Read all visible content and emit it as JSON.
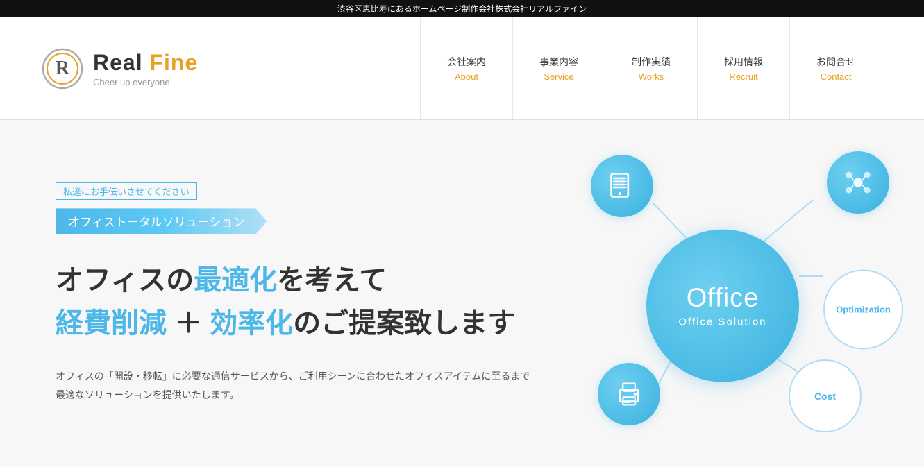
{
  "topbar": {
    "text": "渋谷区恵比寿にあるホームページ制作会社株式会社リアルファイン"
  },
  "header": {
    "logo": {
      "name_part1": "Real ",
      "name_part2": "Fine",
      "tagline": "Cheer up everyone"
    },
    "nav": [
      {
        "ja": "会社案内",
        "en": "About"
      },
      {
        "ja": "事業内容",
        "en": "Service"
      },
      {
        "ja": "制作実績",
        "en": "Works"
      },
      {
        "ja": "採用情報",
        "en": "Recruit"
      },
      {
        "ja": "お問合せ",
        "en": "Contact"
      }
    ]
  },
  "hero": {
    "sub_label": "私達にお手伝いさせてください",
    "badge": "オフィストータルソリューション",
    "title_line1_pre": "オフィスの",
    "title_line1_highlight": "最適化",
    "title_line1_post": "を考えて",
    "title_line2_highlight1": "経費削減",
    "title_line2_mid": "  ＋  ",
    "title_line2_highlight2": "効率化",
    "title_line2_post": "のご提案致します",
    "description_line1": "オフィスの「開設・移転」に必要な通信サービスから、ご利用シーンに合わせたオフィスアイテムに至るまで",
    "description_line2": "最適なソリューションを提供いたします。",
    "diagram": {
      "center_title": "Office",
      "center_sub": "Office Solution",
      "labels": [
        "Optimization",
        "Cost"
      ]
    }
  }
}
